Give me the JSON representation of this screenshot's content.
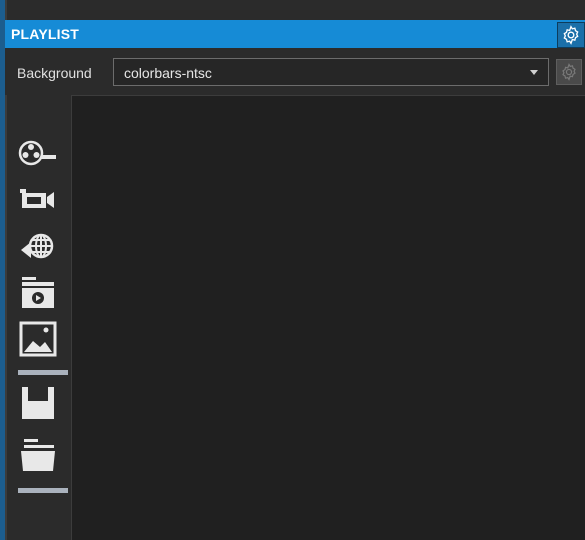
{
  "panel": {
    "title": "PLAYLIST"
  },
  "background": {
    "label": "Background",
    "selected": "colorbars-ntsc"
  },
  "toolbar": {
    "tools": [
      {
        "icon": "film-reel-icon"
      },
      {
        "icon": "video-camera-icon"
      },
      {
        "icon": "web-globe-icon"
      },
      {
        "icon": "media-folder-icon"
      },
      {
        "icon": "image-icon"
      },
      {
        "icon": "save-icon"
      },
      {
        "icon": "open-folder-icon"
      }
    ]
  },
  "colors": {
    "header": "#168bd6",
    "panel_bg": "#2b2b2b",
    "content_bg": "#202020",
    "icon": "#e8e8e8",
    "separator": "#aab2bd"
  }
}
